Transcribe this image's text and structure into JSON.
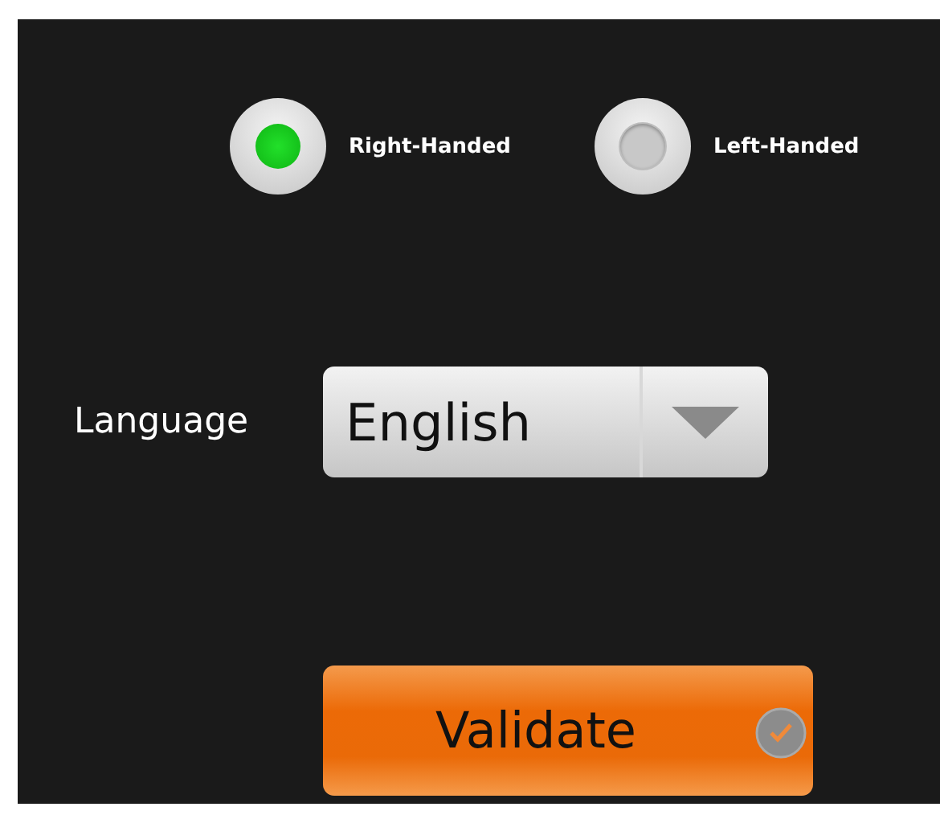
{
  "handedness": [
    {
      "label": "Right-Handed",
      "selected": true
    },
    {
      "label": "Left-Handed",
      "selected": false
    }
  ],
  "language": {
    "label": "Language",
    "value": "English"
  },
  "validate_button": {
    "label": "Validate"
  }
}
